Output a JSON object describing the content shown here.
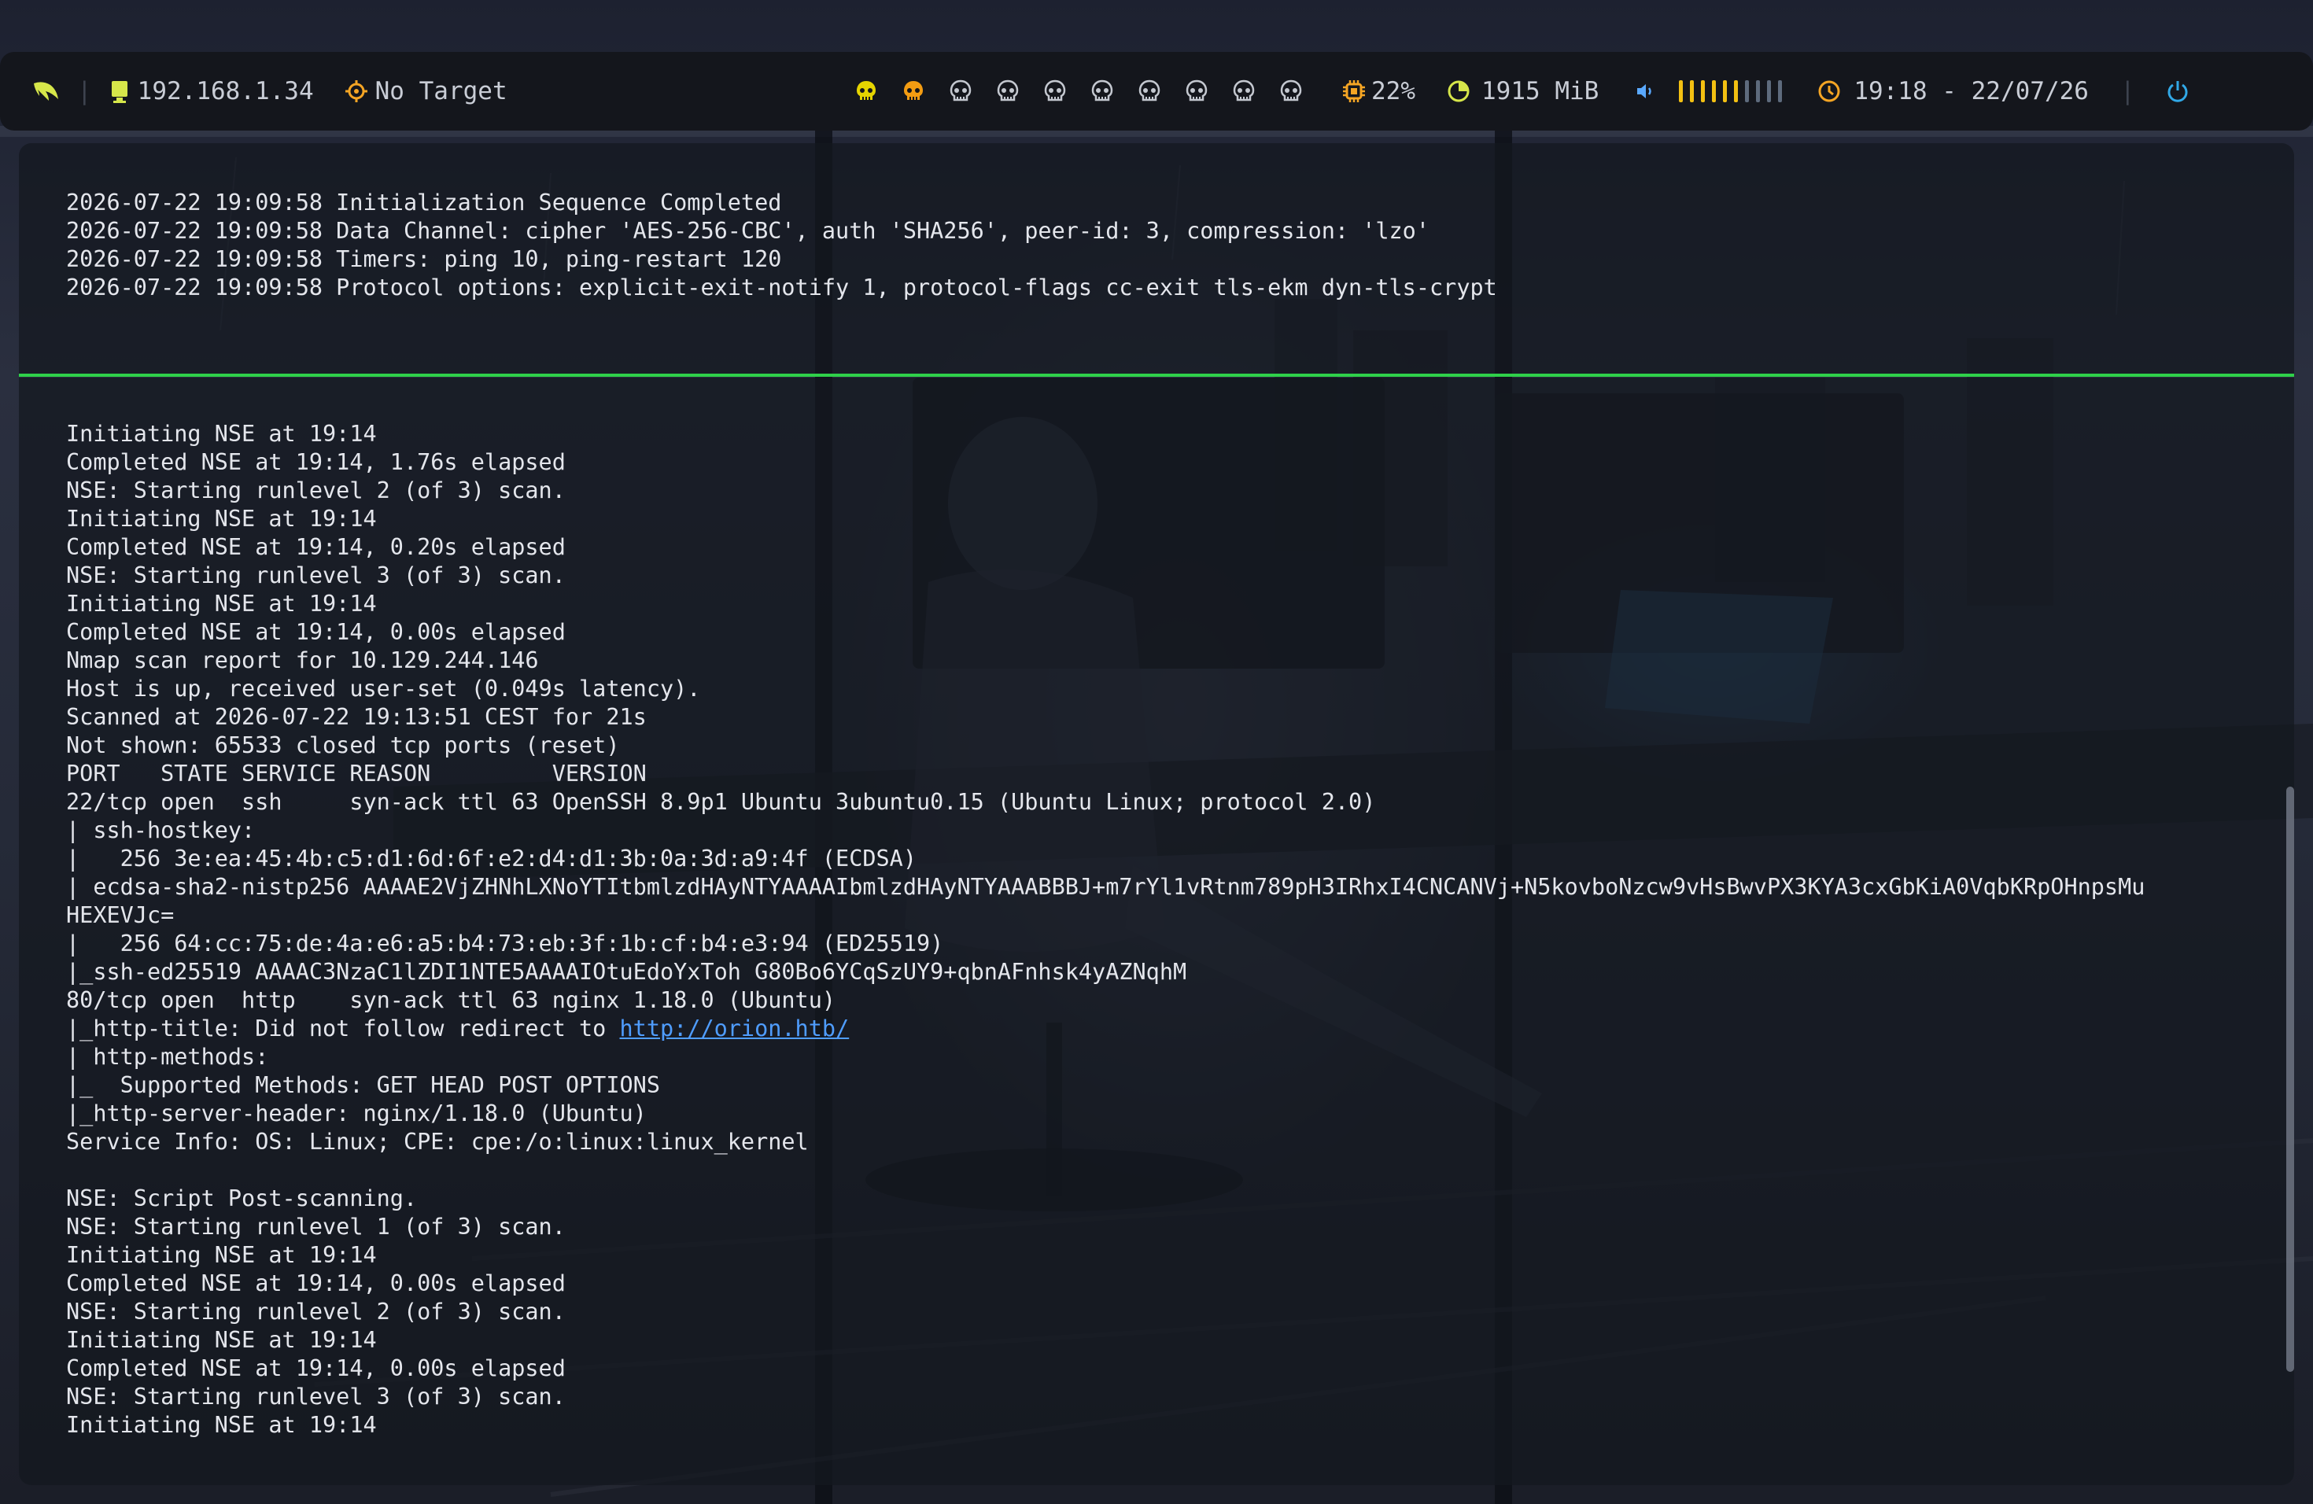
{
  "statusbar": {
    "logo_icon": "feather-icon",
    "ip": "192.168.1.34",
    "target": "No Target",
    "workspaces": [
      {
        "id": "1",
        "icon": "skull-icon",
        "state": "active",
        "color": "#e5d400"
      },
      {
        "id": "2",
        "icon": "skull-icon",
        "state": "occupied",
        "color": "#f39c12"
      },
      {
        "id": "3",
        "icon": "skull-icon",
        "state": "empty",
        "color": "#c4c8d0"
      },
      {
        "id": "4",
        "icon": "skull-icon",
        "state": "empty",
        "color": "#c4c8d0"
      },
      {
        "id": "5",
        "icon": "skull-icon",
        "state": "empty",
        "color": "#c4c8d0"
      },
      {
        "id": "6",
        "icon": "skull-icon",
        "state": "empty",
        "color": "#c4c8d0"
      },
      {
        "id": "7",
        "icon": "skull-icon",
        "state": "empty",
        "color": "#c4c8d0"
      },
      {
        "id": "8",
        "icon": "skull-icon",
        "state": "empty",
        "color": "#c4c8d0"
      },
      {
        "id": "9",
        "icon": "skull-icon",
        "state": "empty",
        "color": "#c4c8d0"
      },
      {
        "id": "10",
        "icon": "skull-icon",
        "state": "empty",
        "color": "#c4c8d0"
      }
    ],
    "cpu": "22%",
    "memory": "1915 MiB",
    "volume_level": 0.6,
    "volume_segments": 10,
    "clock": "19:18 - 22/07/26",
    "colors": {
      "logo": "#d6e64a",
      "ip_icon": "#d6e64a",
      "target_icon": "#f5a524",
      "cpu_icon": "#f5a524",
      "mem_icon": "#d6e64a",
      "volume_icon": "#5aa9ff",
      "volume_on": "#f3c012",
      "volume_off": "#5e6b7d",
      "clock_icon": "#f5a524",
      "power_icon": "#31a8e6"
    }
  },
  "pane_divider_color": "#2fd14a",
  "terminal_top": {
    "lines": [
      "2026-07-22 19:09:58 Initialization Sequence Completed",
      "2026-07-22 19:09:58 Data Channel: cipher 'AES-256-CBC', auth 'SHA256', peer-id: 3, compression: 'lzo'",
      "2026-07-22 19:09:58 Timers: ping 10, ping-restart 120",
      "2026-07-22 19:09:58 Protocol options: explicit-exit-notify 1, protocol-flags cc-exit tls-ekm dyn-tls-crypt"
    ]
  },
  "terminal_bottom": {
    "lines": [
      "Initiating NSE at 19:14",
      "Completed NSE at 19:14, 1.76s elapsed",
      "NSE: Starting runlevel 2 (of 3) scan.",
      "Initiating NSE at 19:14",
      "Completed NSE at 19:14, 0.20s elapsed",
      "NSE: Starting runlevel 3 (of 3) scan.",
      "Initiating NSE at 19:14",
      "Completed NSE at 19:14, 0.00s elapsed",
      "Nmap scan report for 10.129.244.146",
      "Host is up, received user-set (0.049s latency).",
      "Scanned at 2026-07-22 19:13:51 CEST for 21s",
      "Not shown: 65533 closed tcp ports (reset)",
      "PORT   STATE SERVICE REASON         VERSION",
      "22/tcp open  ssh     syn-ack ttl 63 OpenSSH 8.9p1 Ubuntu 3ubuntu0.15 (Ubuntu Linux; protocol 2.0)",
      "| ssh-hostkey:",
      "|   256 3e:ea:45:4b:c5:d1:6d:6f:e2:d4:d1:3b:0a:3d:a9:4f (ECDSA)",
      "| ecdsa-sha2-nistp256 AAAAE2VjZHNhLXNoYTItbmlzdHAyNTYAAAAIbmlzdHAyNTYAAABBBJ+m7rYl1vRtnm789pH3IRhxI4CNCANVj+N5kovboNzcw9vHsBwvPX3KYA3cxGbKiA0VqbKRpOHnpsMu",
      "HEXEVJc=",
      "|   256 64:cc:75:de:4a:e6:a5:b4:73:eb:3f:1b:cf:b4:e3:94 (ED25519)",
      "|_ssh-ed25519 AAAAC3NzaC1lZDI1NTE5AAAAIOtuEdoYxToh G80Bo6YCqSzUY9+qbnAFnhsk4yAZNqhM",
      "80/tcp open  http    syn-ack ttl 63 nginx 1.18.0 (Ubuntu)",
      "|_http-title: Did not follow redirect to ",
      "| http-methods:",
      "|_  Supported Methods: GET HEAD POST OPTIONS",
      "|_http-server-header: nginx/1.18.0 (Ubuntu)",
      "Service Info: OS: Linux; CPE: cpe:/o:linux:linux_kernel",
      "",
      "NSE: Script Post-scanning.",
      "NSE: Starting runlevel 1 (of 3) scan.",
      "Initiating NSE at 19:14",
      "Completed NSE at 19:14, 0.00s elapsed",
      "NSE: Starting runlevel 2 (of 3) scan.",
      "Initiating NSE at 19:14",
      "Completed NSE at 19:14, 0.00s elapsed",
      "NSE: Starting runlevel 3 (of 3) scan.",
      "Initiating NSE at 19:14"
    ],
    "redirect_link": "http://orion.htb/"
  }
}
